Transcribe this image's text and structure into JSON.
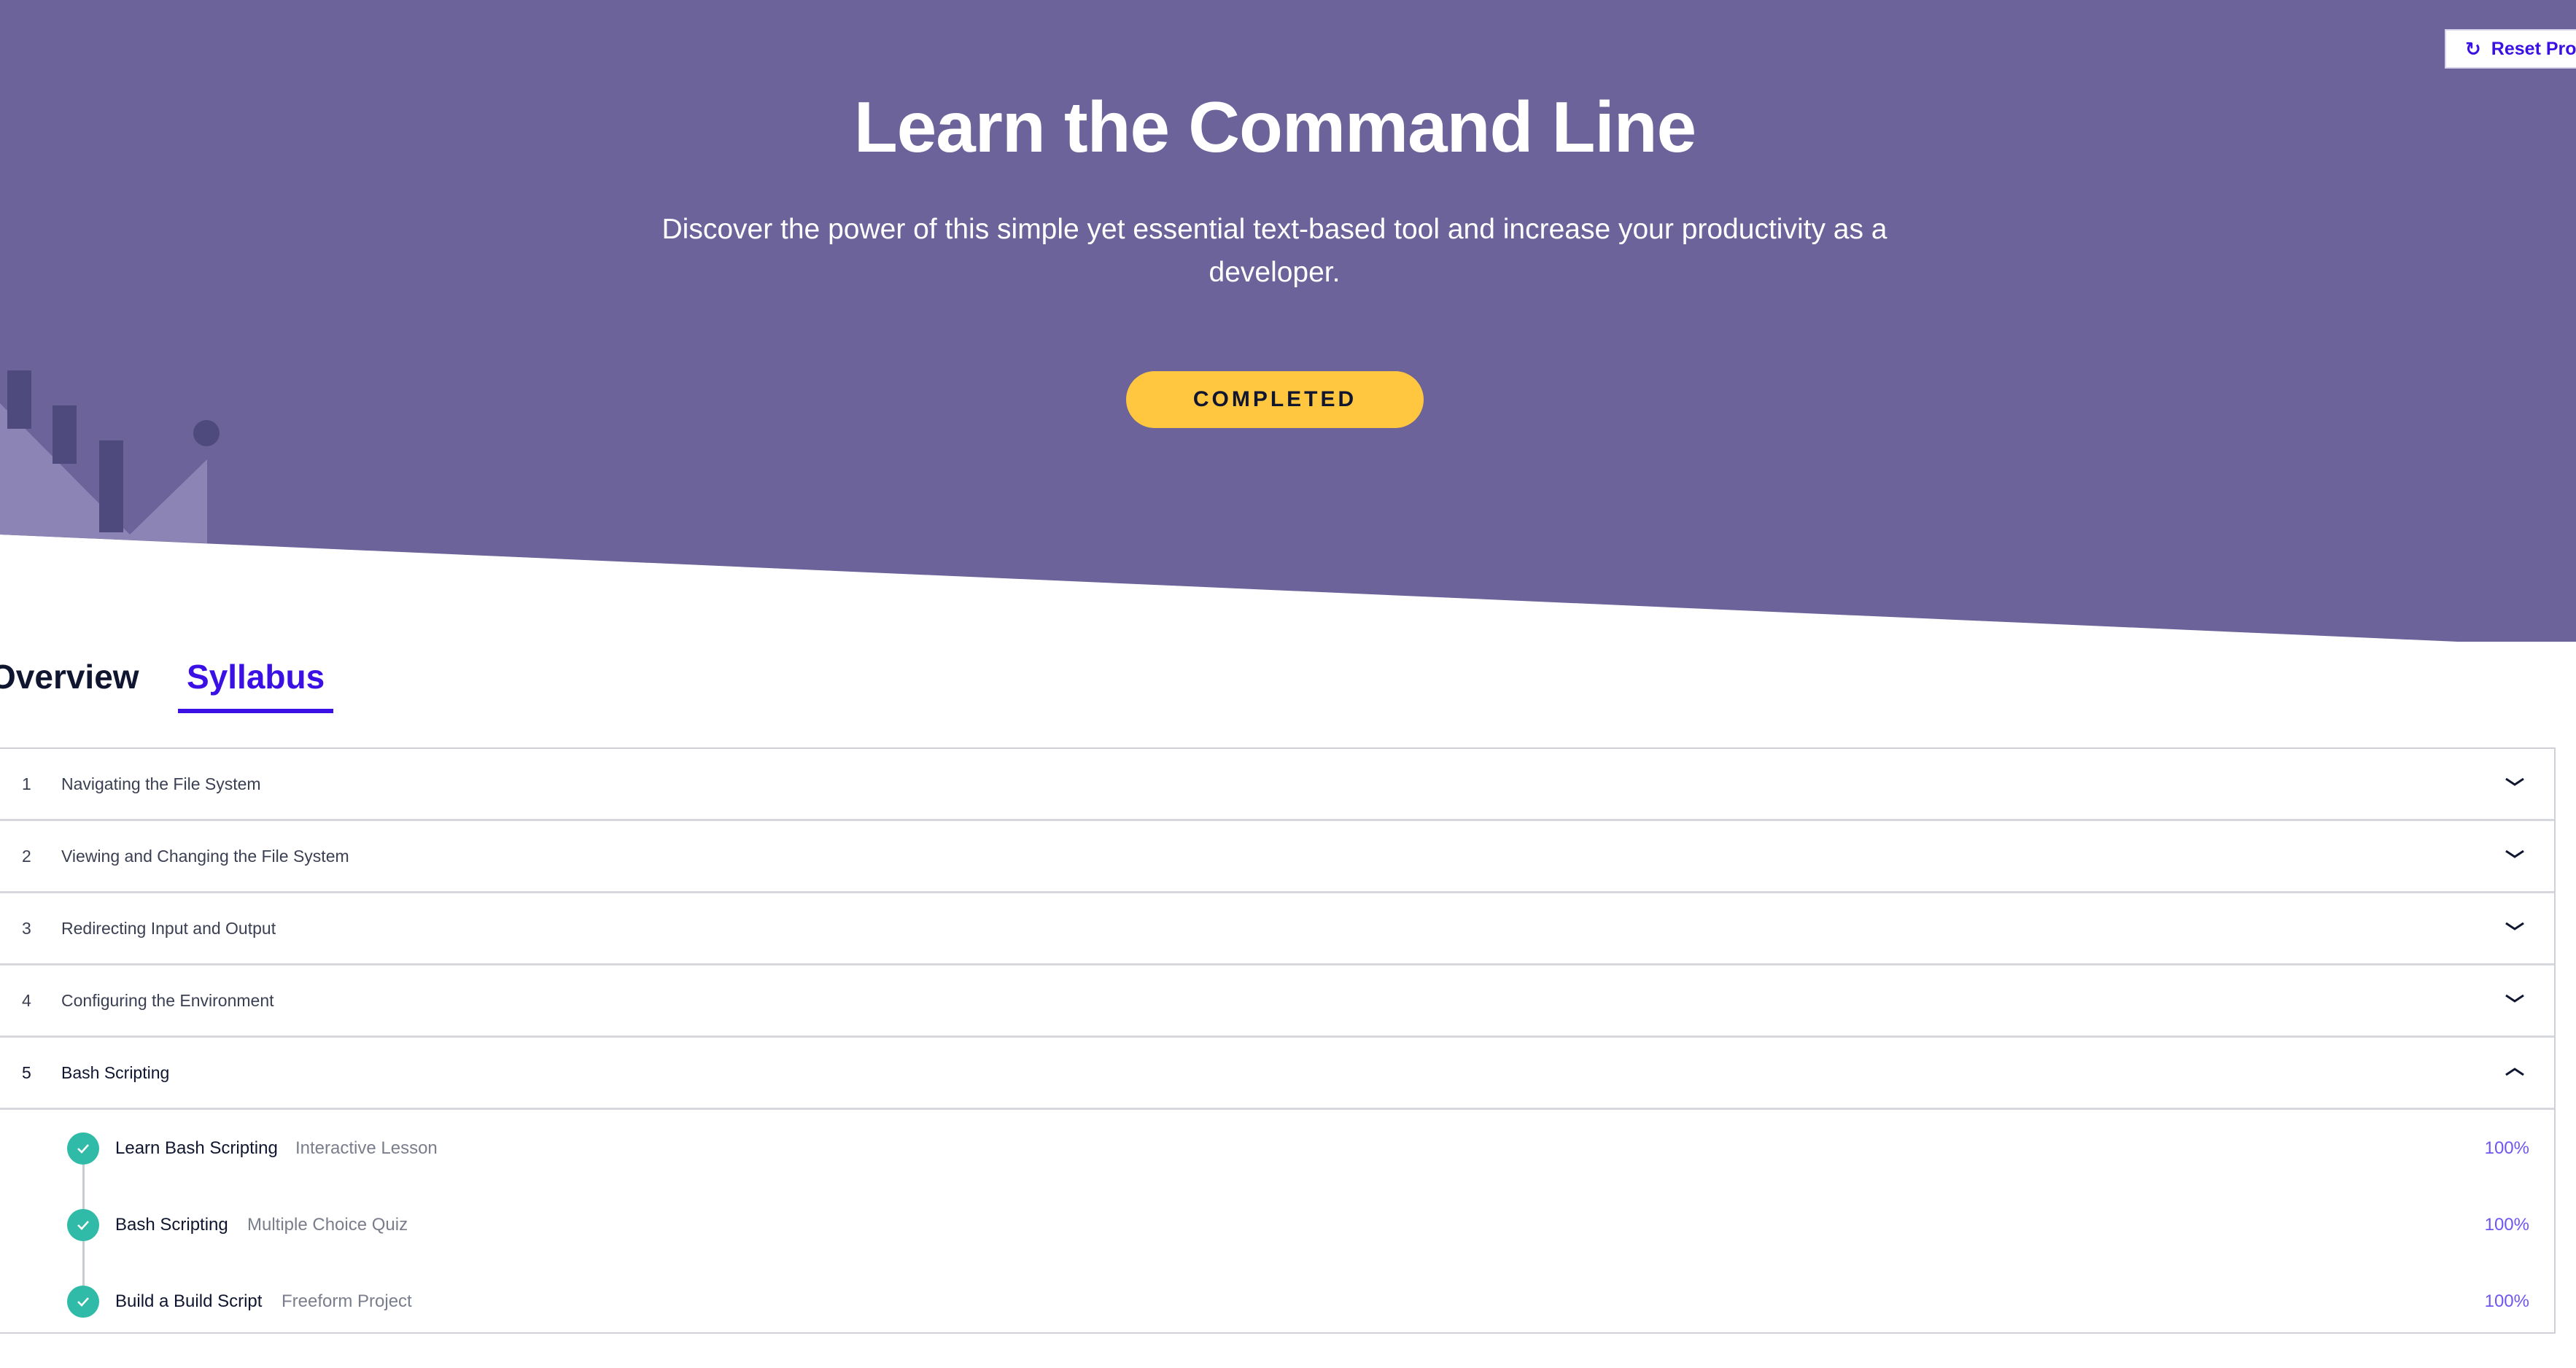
{
  "header": {
    "reset_label": "Reset Prog",
    "title": "Learn the Command Line",
    "subtitle": "Discover the power of this simple yet essential text-based tool and increase your productivity as a developer.",
    "status": "COMPLETED"
  },
  "tabs": [
    {
      "label": "Overview",
      "active": false
    },
    {
      "label": "Syllabus",
      "active": true
    }
  ],
  "modules": [
    {
      "num": "1",
      "title": "Navigating the File System",
      "expanded": false
    },
    {
      "num": "2",
      "title": "Viewing and Changing the File System",
      "expanded": false
    },
    {
      "num": "3",
      "title": "Redirecting Input and Output",
      "expanded": false
    },
    {
      "num": "4",
      "title": "Configuring the Environment",
      "expanded": false
    },
    {
      "num": "5",
      "title": "Bash Scripting",
      "expanded": true
    }
  ],
  "lessons": [
    {
      "name": "Learn Bash Scripting",
      "type": "Interactive Lesson",
      "progress": "100%"
    },
    {
      "name": "Bash Scripting",
      "type": "Multiple Choice Quiz",
      "progress": "100%"
    },
    {
      "name": "Build a Build Script",
      "type": "Freeform Project",
      "progress": "100%"
    }
  ],
  "colors": {
    "hero_bg": "#6b6399",
    "accent": "#3a10e5",
    "pill": "#ffc740",
    "check": "#2fbba7",
    "percent": "#6f55f2"
  },
  "icons": {
    "reset": "refresh-icon",
    "collapsed": "chevron-down-icon",
    "expanded": "chevron-up-icon",
    "complete": "checkmark-icon"
  }
}
